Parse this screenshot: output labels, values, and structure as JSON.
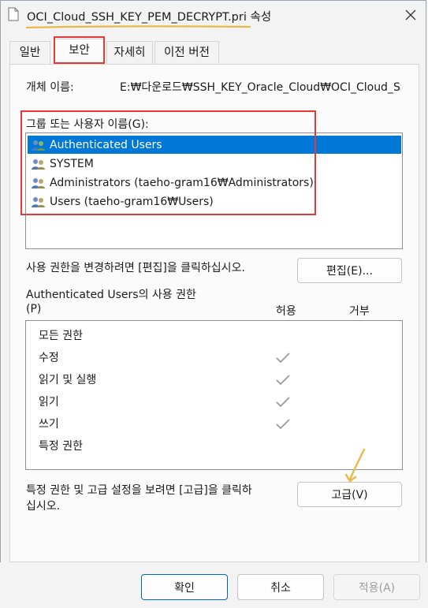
{
  "window": {
    "title": "OCI_Cloud_SSH_KEY_PEM_DECRYPT.pri 속성",
    "accent_underline_color": "#e8b94a",
    "highlight_color": "#e53935"
  },
  "tabs": [
    {
      "label": "일반",
      "active": false
    },
    {
      "label": "보안",
      "active": true
    },
    {
      "label": "자세히",
      "active": false
    },
    {
      "label": "이전 버전",
      "active": false
    }
  ],
  "security": {
    "object_name_label": "개체 이름:",
    "object_name_value": "E:₩다운로드₩SSH_KEY_Oracle_Cloud₩OCI_Cloud_SSH",
    "groups_label": "그룹 또는 사용자 이름(G):",
    "groups": [
      {
        "name": "Authenticated Users",
        "icon": "users-group-icon",
        "selected": true
      },
      {
        "name": "SYSTEM",
        "icon": "users-group-icon",
        "selected": false
      },
      {
        "name": "Administrators (taeho-gram16₩Administrators)",
        "icon": "users-group-icon",
        "selected": false
      },
      {
        "name": "Users (taeho-gram16₩Users)",
        "icon": "users-group-icon",
        "selected": false
      }
    ],
    "edit_hint": "사용 권한을 변경하려면 [편집]을 클릭하십시오.",
    "edit_button": "편집(E)...",
    "permissions_label_line1": "Authenticated Users의 사용 권한",
    "permissions_label_line2": "(P)",
    "allow_header": "허용",
    "deny_header": "거부",
    "permissions": [
      {
        "name": "모든 권한",
        "allow": false,
        "deny": false
      },
      {
        "name": "수정",
        "allow": true,
        "deny": false
      },
      {
        "name": "읽기 및 실행",
        "allow": true,
        "deny": false
      },
      {
        "name": "읽기",
        "allow": true,
        "deny": false
      },
      {
        "name": "쓰기",
        "allow": true,
        "deny": false
      },
      {
        "name": "특정 권한",
        "allow": false,
        "deny": false
      }
    ],
    "advanced_hint_line1": "특정 권한 및 고급 설정을 보려면 [고급]을 클릭하",
    "advanced_hint_line2": "십시오.",
    "advanced_button": "고급(V)"
  },
  "footer": {
    "ok": "확인",
    "cancel": "취소",
    "apply": "적용(A)"
  }
}
